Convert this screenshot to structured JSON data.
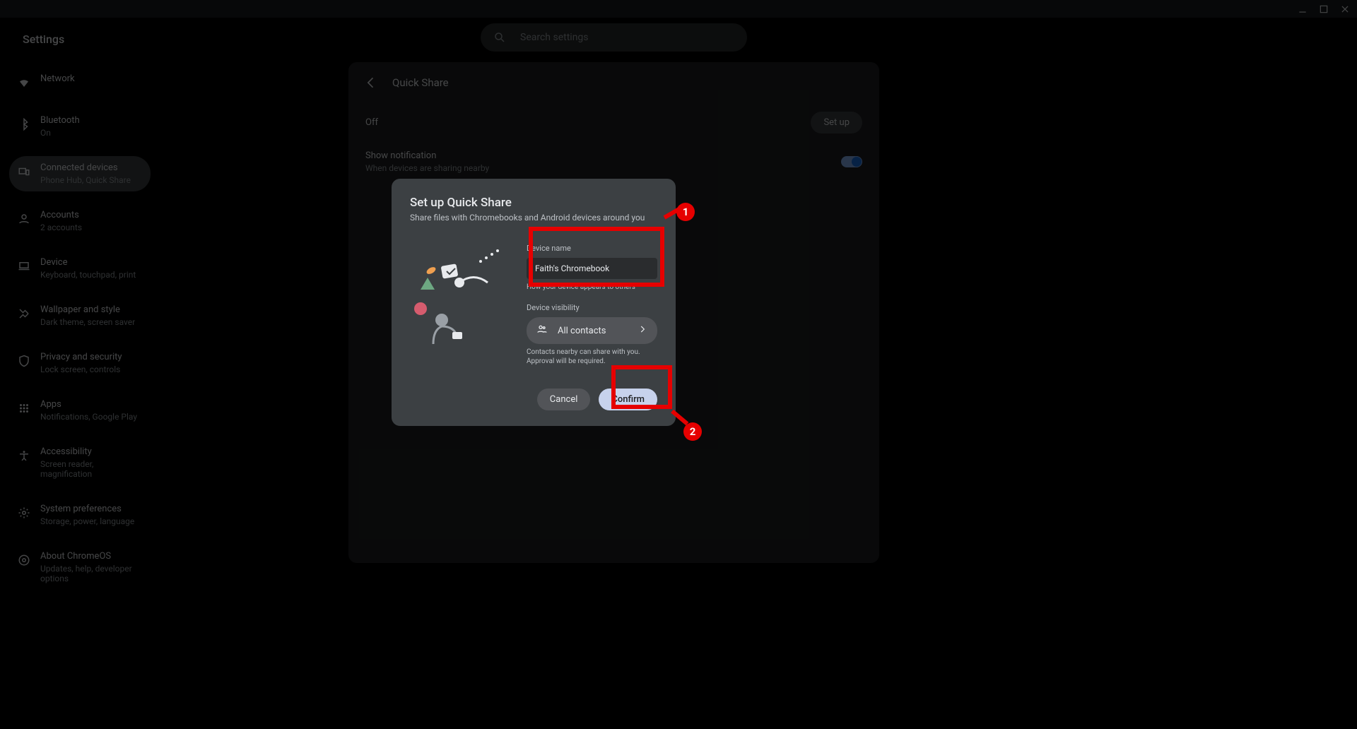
{
  "app": {
    "title": "Settings"
  },
  "search": {
    "placeholder": "Search settings"
  },
  "sidebar": [
    {
      "icon": "wifi",
      "title": "Network",
      "sub": ""
    },
    {
      "icon": "bluetooth",
      "title": "Bluetooth",
      "sub": "On"
    },
    {
      "icon": "devices",
      "title": "Connected devices",
      "sub": "Phone Hub, Quick Share",
      "active": true
    },
    {
      "icon": "account",
      "title": "Accounts",
      "sub": "2 accounts"
    },
    {
      "icon": "laptop",
      "title": "Device",
      "sub": "Keyboard, touchpad, print"
    },
    {
      "icon": "wallpaper",
      "title": "Wallpaper and style",
      "sub": "Dark theme, screen saver"
    },
    {
      "icon": "shield",
      "title": "Privacy and security",
      "sub": "Lock screen, controls"
    },
    {
      "icon": "apps",
      "title": "Apps",
      "sub": "Notifications, Google Play"
    },
    {
      "icon": "accessibility",
      "title": "Accessibility",
      "sub": "Screen reader, magnification"
    },
    {
      "icon": "gear",
      "title": "System preferences",
      "sub": "Storage, power, language"
    },
    {
      "icon": "chrome",
      "title": "About ChromeOS",
      "sub": "Updates, help, developer options"
    }
  ],
  "panel": {
    "title": "Quick Share",
    "off_label": "Off",
    "setup_label": "Set up",
    "notif_title": "Show notification",
    "notif_sub": "When devices are sharing nearby"
  },
  "dialog": {
    "title": "Set up Quick Share",
    "subtitle": "Share files with Chromebooks and Android devices around you",
    "device_name_label": "Device name",
    "device_name_value": "Faith's Chromebook",
    "device_name_help": "How your device appears to others",
    "visibility_label": "Device visibility",
    "visibility_value": "All contacts",
    "visibility_help": "Contacts nearby can share with you. Approval will be required.",
    "cancel": "Cancel",
    "confirm": "Confirm"
  },
  "annotations": {
    "n1": "1",
    "n2": "2"
  }
}
